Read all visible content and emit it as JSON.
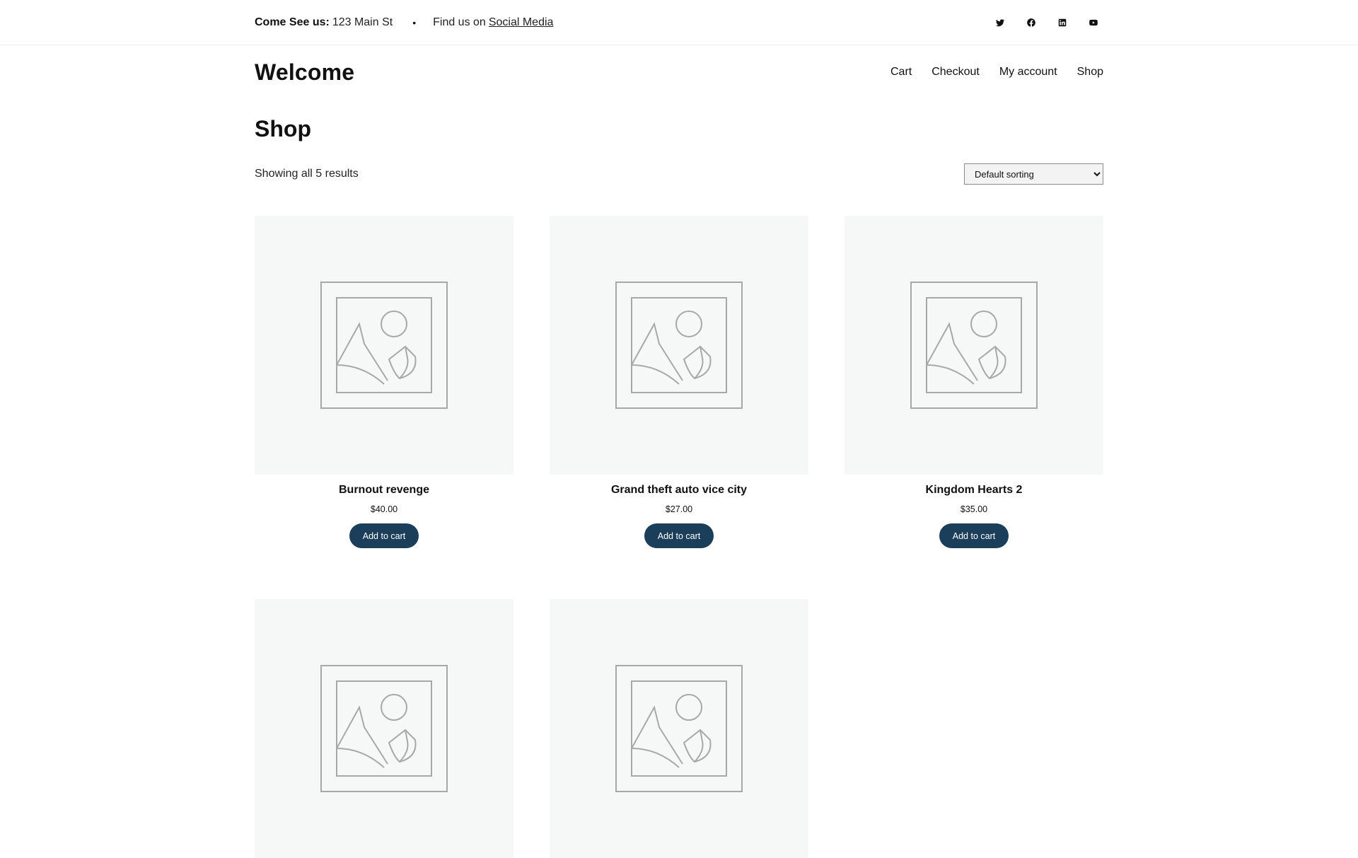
{
  "topbar": {
    "come_label": "Come See us:",
    "address": "123 Main St",
    "dot": "•",
    "findus_label": "Find us on",
    "social_link": "Social Media",
    "icons": [
      "twitter-icon",
      "facebook-icon",
      "linkedin-icon",
      "youtube-icon"
    ]
  },
  "header": {
    "site_title": "Welcome",
    "nav": [
      "Cart",
      "Checkout",
      "My account",
      "Shop"
    ]
  },
  "page": {
    "title": "Shop",
    "results_count": "Showing all 5 results",
    "sort_selected": "Default sorting"
  },
  "products": [
    {
      "name": "Burnout revenge",
      "price": "$40.00",
      "button": "Add to cart"
    },
    {
      "name": "Grand theft auto vice city",
      "price": "$27.00",
      "button": "Add to cart"
    },
    {
      "name": "Kingdom Hearts 2",
      "price": "$35.00",
      "button": "Add to cart"
    },
    {
      "name": "",
      "price": "",
      "button": ""
    },
    {
      "name": "",
      "price": "",
      "button": ""
    }
  ],
  "colors": {
    "button_bg": "#1b3f5a",
    "image_bg": "#f6f7f7",
    "placeholder_stroke": "#a8a8a8"
  }
}
